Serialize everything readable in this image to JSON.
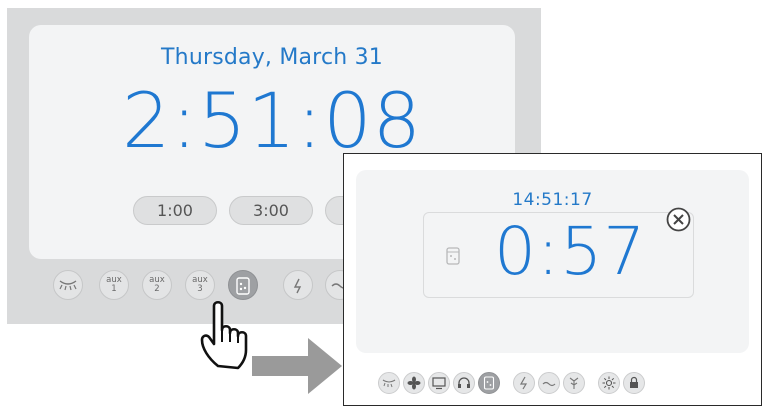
{
  "back_panel": {
    "date": "Thursday, March 31",
    "time": "2:51:08",
    "presets": [
      "1:00",
      "3:00"
    ],
    "buttons": [
      {
        "name": "lamp-icon",
        "label": ""
      },
      {
        "name": "aux-1",
        "label": "aux",
        "sub": "1"
      },
      {
        "name": "aux-2",
        "label": "aux",
        "sub": "2"
      },
      {
        "name": "aux-3",
        "label": "aux",
        "sub": "3"
      },
      {
        "name": "timer-icon",
        "label": ""
      },
      {
        "name": "lightning-icon",
        "label": ""
      },
      {
        "name": "wave-icon",
        "label": ""
      }
    ]
  },
  "front_panel": {
    "clock": "14:51:17",
    "timer": "0:57",
    "buttons": [
      "lamp-icon",
      "fan-icon",
      "monitor-icon",
      "headphones-icon",
      "timer-icon",
      "lightning-icon",
      "wave-icon",
      "antenna-icon",
      "sun-icon",
      "lock-icon"
    ]
  },
  "colors": {
    "accent": "#1f78d1",
    "panel": "#d9dadb",
    "screen": "#f3f4f5",
    "active_button": "#9ea0a3"
  }
}
